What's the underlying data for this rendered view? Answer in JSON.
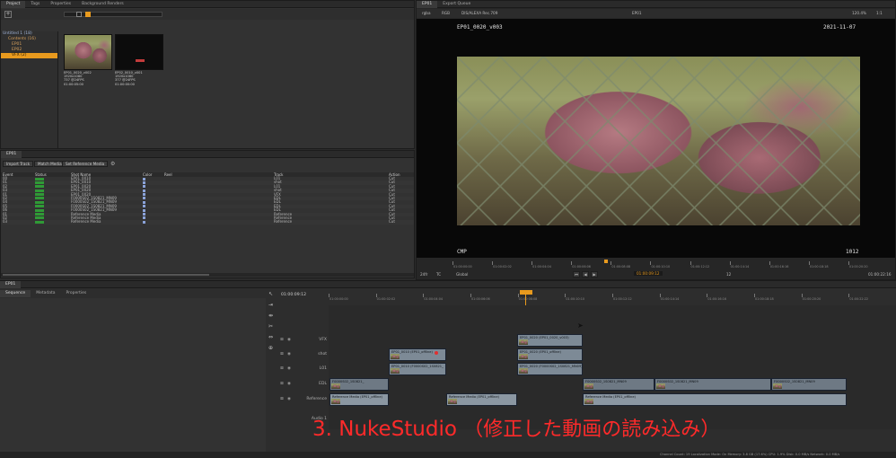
{
  "project_panel": {
    "tabs": [
      "Project",
      "Tags",
      "Properties",
      "Background Renders"
    ],
    "tree": [
      {
        "label": "Untitled 1 (18)",
        "selected": false
      },
      {
        "label": "Contents (16)",
        "selected": false
      },
      {
        "label": "EP01",
        "selected": false
      },
      {
        "label": "EP02",
        "selected": false
      },
      {
        "label": "VFX (2)",
        "selected": true
      }
    ],
    "thumbs": [
      {
        "title": "EP01_0020_v002",
        "meta1": "1920x1080",
        "meta2": "737 @24FPS",
        "meta3": "01:00:05:00"
      },
      {
        "title": "EP02_0010_v001",
        "meta1": "1920x1080",
        "meta2": "377 @24FPS",
        "meta3": "01:00:00:00"
      }
    ]
  },
  "sequence_panel": {
    "tab": "EP01",
    "buttons": {
      "import_track": "Import Track",
      "match_media": "Match Media",
      "set_reference": "Set Reference Media"
    },
    "columns": {
      "event": "Event",
      "status": "Status",
      "shot": "Shot Name",
      "color": "Color",
      "reel": "Reel",
      "track": "Track",
      "action": "Action"
    },
    "rows": [
      {
        "event": "00",
        "shot": "EP01_0010",
        "track": "L01",
        "action": "Cut"
      },
      {
        "event": "01",
        "shot": "EP01_0010",
        "track": "shot",
        "action": "Cut"
      },
      {
        "event": "02",
        "shot": "EP01_0020",
        "track": "L01",
        "action": "Cut"
      },
      {
        "event": "03",
        "shot": "EP01_0020",
        "track": "shot",
        "action": "Cut"
      },
      {
        "event": "01",
        "shot": "EP01_0020",
        "track": "VFX",
        "action": "Cut"
      },
      {
        "event": "02",
        "shot": "F0000S02_1S0821_MN09",
        "track": "EDL",
        "action": "Cut"
      },
      {
        "event": "04",
        "shot": "F0000S02_1S0821_MN09",
        "track": "EDL",
        "action": "Cut"
      },
      {
        "event": "05",
        "shot": "F0000S02_1S0821_MN09",
        "track": "EDL",
        "action": "Cut"
      },
      {
        "event": "06",
        "shot": "F0000S02_1S0821_MN09",
        "track": "EDL",
        "action": "Cut"
      },
      {
        "event": "01",
        "shot": "Reference Media",
        "track": "Reference",
        "action": "Cut"
      },
      {
        "event": "02",
        "shot": "Reference Media",
        "track": "Reference",
        "action": "Cut"
      },
      {
        "event": "03",
        "shot": "Reference Media",
        "track": "Reference",
        "action": "Cut"
      }
    ]
  },
  "viewer": {
    "tabs": [
      "EP01",
      "Export Queue"
    ],
    "toolbar": {
      "channel": "rgba",
      "colorspace": "RGB",
      "lut": "DIS/ALEXA Rec.709",
      "clip": "EP01",
      "zoom": "120.4%",
      "ratio": "1:1"
    },
    "burnin_top_left": "EP01_0020_v003",
    "burnin_top_right": "2021-11-07",
    "burnin_bottom_left": "CMP",
    "burnin_bottom_right": "1012",
    "ruler_labels": [
      "01:00:00:00",
      "01:00:02:02",
      "01:00:04:04",
      "01:00:06:06",
      "01:00:08:08",
      "01:00:10:10",
      "01:00:12:12",
      "01:00:14:14",
      "01:00:16:16",
      "01:00:18:18",
      "01:00:20:20"
    ],
    "fps": "24fr",
    "tc": "TC",
    "mode": "Global",
    "timecode_in": "01:00:00:00",
    "timecode_current": "01:00:09:12",
    "timecode_out": "01:00:22:16",
    "step": "12"
  },
  "timeline": {
    "tab": "EP01",
    "subtabs": [
      "Sequence",
      "Metadata",
      "Properties"
    ],
    "current_tc": "01:00:09:12",
    "ruler_labels": [
      "01:00:00:00",
      "01:00:02:02",
      "01:00:04:04",
      "01:00:06:06",
      "01:00:08:08",
      "01:00:10:10",
      "01:00:12:12",
      "01:00:14:14",
      "01:00:16:16",
      "01:00:18:18",
      "01:00:20:20",
      "01:00:22:22"
    ],
    "tracks": [
      "VFX",
      "shot",
      "L01",
      "EDL",
      "Reference"
    ],
    "audio_track": "Audio 1",
    "clips": {
      "vfx": "EP01_0020 (EP01_0020_v003)",
      "shot1": "EP01_0010 (EP01_offline)",
      "shot2": "EP01_0020 (EP01_offline)",
      "l01_1": "EP01_0010 (F0000S02_1S0821_",
      "l01_2": "EP01_0020 (F0000S02_1S0821_MN09)",
      "edl1": "F0000S02_1S0821_",
      "edl2": "F0000S02_1S0821_MN09",
      "edl3": "F0000S02_1S0821_MN09",
      "edl4": "F0000S02_1S0821_MN09",
      "ref1": "Reference Media (EP01_offline)",
      "ref2": "Reference Media (EP01_offline)",
      "ref3": "Reference Media (EP01_offline)"
    }
  },
  "status_bar": "Channel Count: 19  Localization Mode: On  Memory: 3.8 GB (17.6%)  CPU: 1.9%  Disk: 0.0 MB/s  Network: 0.0 MB/s",
  "caption": {
    "number": "3. NukeStudio",
    "subtitle": "（修正した動画の読み込み）",
    "color": "#ff2a2a"
  },
  "accent": "#e89a1e"
}
